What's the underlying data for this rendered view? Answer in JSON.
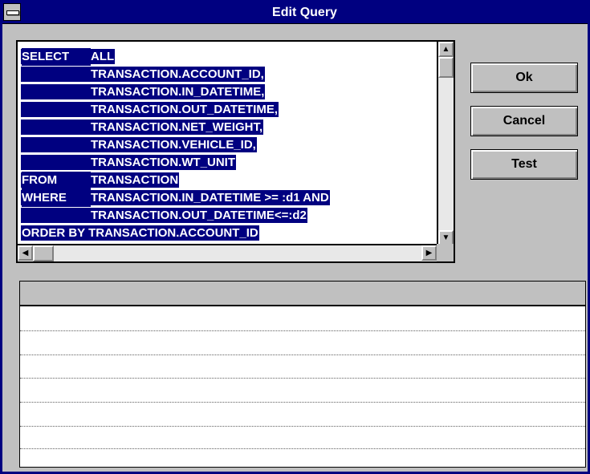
{
  "window": {
    "title": "Edit Query"
  },
  "sql": {
    "lines": [
      {
        "kw": "SELECT",
        "text": "ALL"
      },
      {
        "kw": "",
        "text": "TRANSACTION.ACCOUNT_ID,"
      },
      {
        "kw": "",
        "text": "TRANSACTION.IN_DATETIME,"
      },
      {
        "kw": "",
        "text": "TRANSACTION.OUT_DATETIME,"
      },
      {
        "kw": "",
        "text": "TRANSACTION.NET_WEIGHT,"
      },
      {
        "kw": "",
        "text": "TRANSACTION.VEHICLE_ID,"
      },
      {
        "kw": "",
        "text": "TRANSACTION.WT_UNIT"
      },
      {
        "kw": "FROM",
        "text": "TRANSACTION"
      },
      {
        "kw": "WHERE",
        "text": "TRANSACTION.IN_DATETIME >= :d1 AND"
      },
      {
        "kw": "",
        "text": "TRANSACTION.OUT_DATETIME<=:d2"
      },
      {
        "full": "ORDER BY TRANSACTION.ACCOUNT_ID"
      }
    ]
  },
  "buttons": {
    "ok": "Ok",
    "cancel": "Cancel",
    "test": "Test"
  },
  "scroll": {
    "up_icon": "arrow-up-icon",
    "down_icon": "arrow-down-icon",
    "left_icon": "arrow-left-icon",
    "right_icon": "arrow-right-icon"
  }
}
